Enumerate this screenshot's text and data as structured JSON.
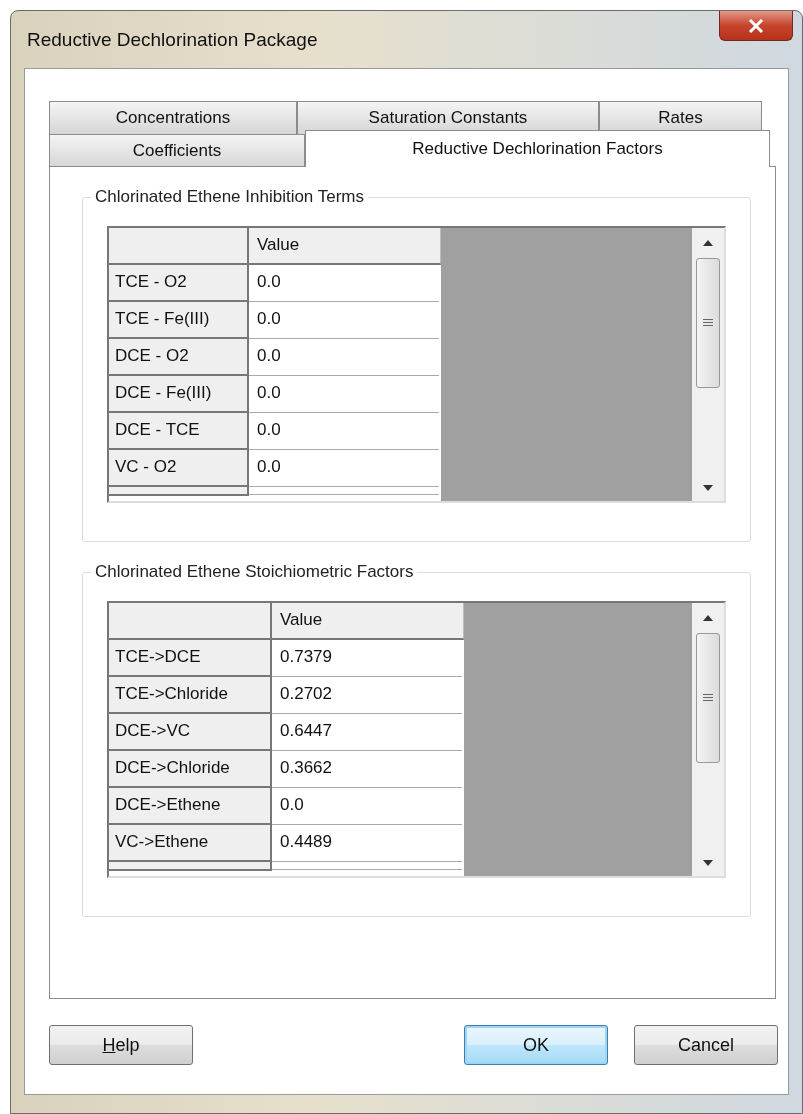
{
  "window": {
    "title": "Reductive Dechlorination Package"
  },
  "tab_rows": [
    [
      {
        "label": "Concentrations",
        "selected": false
      },
      {
        "label": "Saturation Constants",
        "selected": false
      },
      {
        "label": "Rates",
        "selected": false
      }
    ],
    [
      {
        "label": "Coefficients",
        "selected": false
      },
      {
        "label": "Reductive Dechlorination Factors",
        "selected": true
      }
    ]
  ],
  "groups": [
    {
      "title": "Chlorinated Ethene Inhibition Terms",
      "columns": [
        "Value"
      ],
      "rows": [
        {
          "label": "TCE - O2",
          "value": "0.0"
        },
        {
          "label": "TCE - Fe(III)",
          "value": "0.0"
        },
        {
          "label": "DCE - O2",
          "value": "0.0"
        },
        {
          "label": "DCE - Fe(III)",
          "value": "0.0"
        },
        {
          "label": "DCE - TCE",
          "value": "0.0"
        },
        {
          "label": "VC - O2",
          "value": "0.0"
        }
      ]
    },
    {
      "title": "Chlorinated Ethene Stoichiometric Factors",
      "columns": [
        "Value"
      ],
      "rows": [
        {
          "label": "TCE->DCE",
          "value": "0.7379"
        },
        {
          "label": "TCE->Chloride",
          "value": "0.2702"
        },
        {
          "label": "DCE->VC",
          "value": "0.6447"
        },
        {
          "label": "DCE->Chloride",
          "value": "0.3662"
        },
        {
          "label": "DCE->Ethene",
          "value": "0.0"
        },
        {
          "label": "VC->Ethene",
          "value": "0.4489"
        }
      ]
    }
  ],
  "buttons": [
    {
      "label": "Help",
      "first_letter_underlined": true,
      "default": false
    },
    {
      "label": "OK",
      "default": true
    },
    {
      "label": "Cancel",
      "default": false
    }
  ]
}
